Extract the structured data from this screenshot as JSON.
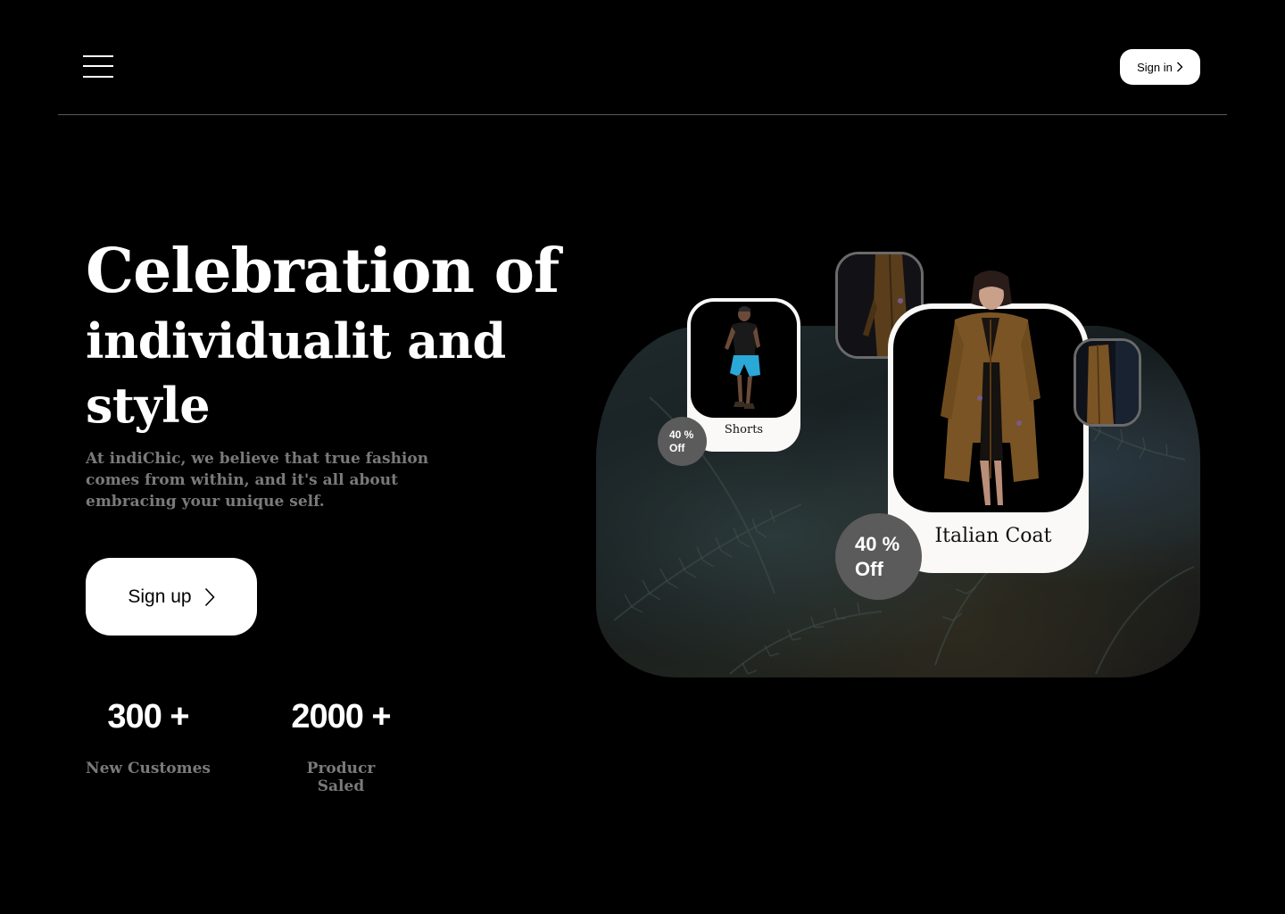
{
  "header": {
    "menu_icon": "hamburger-menu-icon",
    "signin_label": "Sign in"
  },
  "hero": {
    "title_line1": "Celebration of",
    "title_line2": "individualit and",
    "title_line3": "style",
    "description": "At indiChic, we believe that true fashion comes from within, and it's all about embracing your unique self.",
    "signup_label": "Sign up"
  },
  "stats": [
    {
      "value": "300 +",
      "label": "New Customes"
    },
    {
      "value": "2000 +",
      "label": "Producr Saled"
    }
  ],
  "products": [
    {
      "name": "Shorts",
      "discount": "40 %",
      "discount_suffix": "Off"
    },
    {
      "name": "Italian Coat",
      "discount": "40 %",
      "discount_suffix": "Off"
    }
  ],
  "colors": {
    "background": "#000000",
    "button_bg": "#ffffff",
    "muted_text": "#7a7a7a",
    "badge_bg": "#5b5b5b",
    "card_bg": "#fbf9f7"
  }
}
